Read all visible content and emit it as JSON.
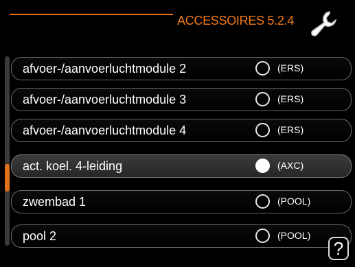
{
  "header": {
    "title": "ACCESSOIRES 5.2.4",
    "icon": "wrench-icon",
    "accent_color": "#e0701a"
  },
  "rows": [
    {
      "label": "afvoer-/aanvoerluchtmodule 2",
      "tag": "(ERS)",
      "checked": false
    },
    {
      "label": "afvoer-/aanvoerluchtmodule 3",
      "tag": "(ERS)",
      "checked": false
    },
    {
      "label": "afvoer-/aanvoerluchtmodule 4",
      "tag": "(ERS)",
      "checked": false
    },
    {
      "label": "act. koel. 4-leiding",
      "tag": "(AXC)",
      "checked": true,
      "selected": true
    },
    {
      "label": "zwembad 1",
      "tag": "(POOL)",
      "checked": false
    },
    {
      "label": "pool 2",
      "tag": "(POOL)",
      "checked": false
    }
  ],
  "help": {
    "label": "?",
    "icon": "question-mark-icon"
  }
}
